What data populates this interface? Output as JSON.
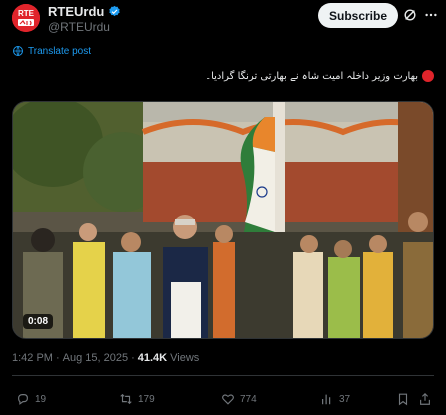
{
  "author": {
    "display_name": "RTEUrdu",
    "handle": "@RTEUrdu",
    "avatar_text": "RTE اردو",
    "verified": true
  },
  "header": {
    "subscribe_label": "Subscribe",
    "grok_icon": "grok-icon",
    "more_icon": "more-icon"
  },
  "translate_label": "Translate post",
  "post_text": "بھارت وزیر داخلہ امیت شاہ نے بھارتی ترنگا گرادیا۔",
  "media": {
    "duration": "0:08",
    "type": "video"
  },
  "meta": {
    "time": "1:42 PM",
    "separator": "·",
    "date": "Aug 15, 2025",
    "views_count": "41.4K",
    "views_label": "Views"
  },
  "actions": {
    "replies": "19",
    "reposts": "179",
    "likes": "774",
    "bookmarks": "37"
  },
  "colors": {
    "background": "#000000",
    "accent": "#1d9bf0",
    "brand_red": "#e0242b",
    "muted": "#71767b",
    "text": "#e7e9ea"
  }
}
